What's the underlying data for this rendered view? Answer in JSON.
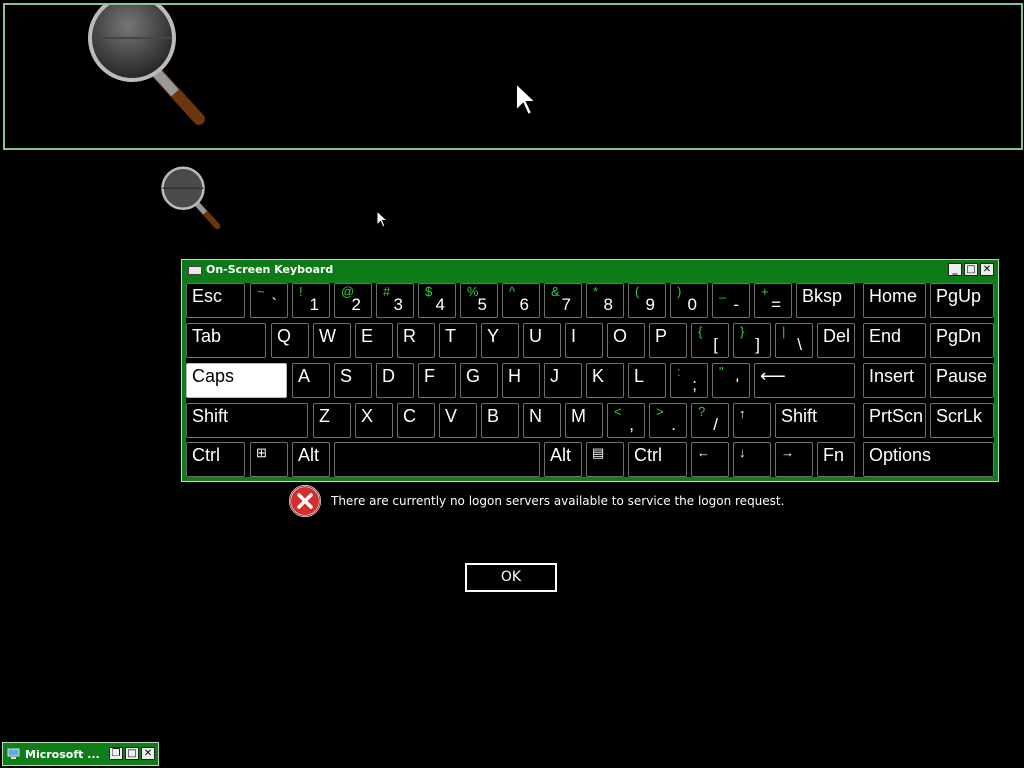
{
  "colors": {
    "window_accent": "#0f7d1a",
    "shift_char": "#2fcf35",
    "error_red": "#d32f2f"
  },
  "osk": {
    "title": "On-Screen Keyboard",
    "title_icon": "keyboard-icon",
    "window_buttons": {
      "minimize": "_",
      "maximize": "□",
      "close": "✕"
    },
    "keys": {
      "esc": "Esc",
      "bksp": "Bksp",
      "home": "Home",
      "pgup": "PgUp",
      "tab": "Tab",
      "del": "Del",
      "end": "End",
      "pgdn": "PgDn",
      "caps": "Caps",
      "enter": "⟵",
      "insert": "Insert",
      "pause": "Pause",
      "shift_left": "Shift",
      "shift_right": "Shift",
      "up": "↑",
      "prtscn": "PrtScn",
      "scrlk": "ScrLk",
      "ctrl_left": "Ctrl",
      "win": "⊞",
      "alt_left": "Alt",
      "space": "",
      "alt_right": "Alt",
      "menu": "▤",
      "ctrl_right": "Ctrl",
      "left": "←",
      "down": "↓",
      "right": "→",
      "fn": "Fn",
      "options": "Options",
      "num": [
        {
          "s": "~",
          "c": "`"
        },
        {
          "s": "!",
          "c": "1"
        },
        {
          "s": "@",
          "c": "2"
        },
        {
          "s": "#",
          "c": "3"
        },
        {
          "s": "$",
          "c": "4"
        },
        {
          "s": "%",
          "c": "5"
        },
        {
          "s": "^",
          "c": "6"
        },
        {
          "s": "&",
          "c": "7"
        },
        {
          "s": "*",
          "c": "8"
        },
        {
          "s": "(",
          "c": "9"
        },
        {
          "s": ")",
          "c": "0"
        },
        {
          "s": "_",
          "c": "-"
        },
        {
          "s": "+",
          "c": "="
        }
      ],
      "q_row": [
        "Q",
        "W",
        "E",
        "R",
        "T",
        "Y",
        "U",
        "I",
        "O",
        "P"
      ],
      "q_row_sym": [
        {
          "s": "{",
          "c": "["
        },
        {
          "s": "}",
          "c": "]"
        },
        {
          "s": "|",
          "c": "\\"
        }
      ],
      "a_row": [
        "A",
        "S",
        "D",
        "F",
        "G",
        "H",
        "J",
        "K",
        "L"
      ],
      "a_row_sym": [
        {
          "s": ":",
          "c": ";"
        },
        {
          "s": "\"",
          "c": "'"
        }
      ],
      "z_row": [
        "Z",
        "X",
        "C",
        "V",
        "B",
        "N",
        "M"
      ],
      "z_row_sym": [
        {
          "s": "<",
          "c": ","
        },
        {
          "s": ">",
          "c": "."
        },
        {
          "s": "?",
          "c": "/"
        }
      ]
    }
  },
  "dialog": {
    "message": "There are currently no logon servers available to service the logon request.",
    "ok_label": "OK",
    "icon": "error-icon"
  },
  "taskbar": {
    "label": "Microsoft ...",
    "buttons": {
      "restore": "❐",
      "maximize": "□",
      "close": "✕"
    }
  }
}
